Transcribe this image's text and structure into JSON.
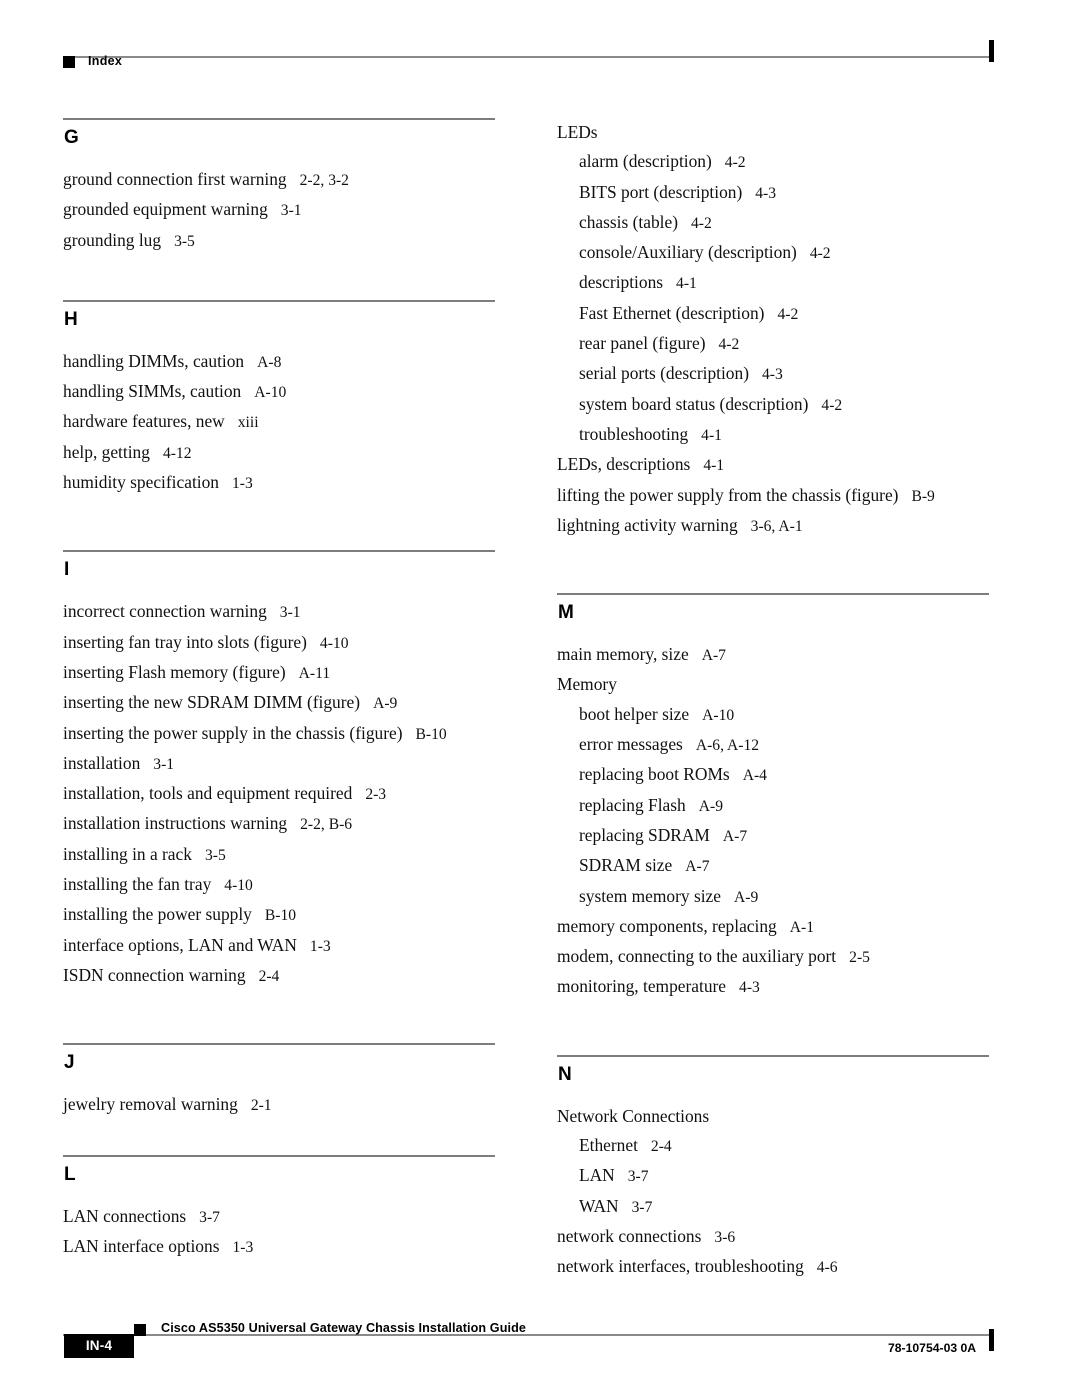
{
  "header": {
    "running_head": "Index",
    "bullet_icon": "black-square-icon"
  },
  "footer": {
    "page_number": "IN-4",
    "document_title": "Cisco AS5350 Universal Gateway Chassis Installation Guide",
    "document_number": "78-10754-03 0A",
    "bullet_icon": "black-square-icon"
  },
  "columns": {
    "left": [
      {
        "letter": "G",
        "entries": [
          {
            "term": "ground connection first warning",
            "locator": "2-2, 3-2",
            "level": 0
          },
          {
            "term": "grounded equipment warning",
            "locator": "3-1",
            "level": 0
          },
          {
            "term": "grounding lug",
            "locator": "3-5",
            "level": 0
          }
        ]
      },
      {
        "letter": "H",
        "entries": [
          {
            "term": "handling DIMMs, caution",
            "locator": "A-8",
            "level": 0
          },
          {
            "term": "handling SIMMs, caution",
            "locator": "A-10",
            "level": 0
          },
          {
            "term": "hardware features, new",
            "locator": "xiii",
            "level": 0
          },
          {
            "term": "help, getting",
            "locator": "4-12",
            "level": 0
          },
          {
            "term": "humidity specification",
            "locator": "1-3",
            "level": 0
          }
        ]
      },
      {
        "letter": "I",
        "entries": [
          {
            "term": "incorrect connection warning",
            "locator": "3-1",
            "level": 0
          },
          {
            "term": "inserting fan tray into slots (figure)",
            "locator": "4-10",
            "level": 0
          },
          {
            "term": "inserting Flash memory (figure)",
            "locator": "A-11",
            "level": 0
          },
          {
            "term": "inserting the new SDRAM DIMM (figure)",
            "locator": "A-9",
            "level": 0
          },
          {
            "term": "inserting the power supply in the chassis (figure)",
            "locator": "B-10",
            "level": 0
          },
          {
            "term": "installation",
            "locator": "3-1",
            "level": 0
          },
          {
            "term": "installation, tools and equipment required",
            "locator": "2-3",
            "level": 0
          },
          {
            "term": "installation instructions warning",
            "locator": "2-2, B-6",
            "level": 0
          },
          {
            "term": "installing in a rack",
            "locator": "3-5",
            "level": 0
          },
          {
            "term": "installing the fan tray",
            "locator": "4-10",
            "level": 0
          },
          {
            "term": "installing the power supply",
            "locator": "B-10",
            "level": 0
          },
          {
            "term": "interface options, LAN and WAN",
            "locator": "1-3",
            "level": 0
          },
          {
            "term": "ISDN connection warning",
            "locator": "2-4",
            "level": 0
          }
        ]
      },
      {
        "letter": "J",
        "entries": [
          {
            "term": "jewelry removal warning",
            "locator": "2-1",
            "level": 0
          }
        ]
      },
      {
        "letter": "L",
        "entries": [
          {
            "term": "LAN connections",
            "locator": "3-7",
            "level": 0
          },
          {
            "term": "LAN interface options",
            "locator": "1-3",
            "level": 0
          }
        ]
      }
    ],
    "right": [
      {
        "letter": "",
        "entries": [
          {
            "term": "LEDs",
            "locator": "",
            "level": 0
          },
          {
            "term": "alarm (description)",
            "locator": "4-2",
            "level": 1
          },
          {
            "term": "BITS port (description)",
            "locator": "4-3",
            "level": 1
          },
          {
            "term": "chassis (table)",
            "locator": "4-2",
            "level": 1
          },
          {
            "term": "console/Auxiliary (description)",
            "locator": "4-2",
            "level": 1
          },
          {
            "term": "descriptions",
            "locator": "4-1",
            "level": 1
          },
          {
            "term": "Fast Ethernet (description)",
            "locator": "4-2",
            "level": 1
          },
          {
            "term": "rear panel (figure)",
            "locator": "4-2",
            "level": 1
          },
          {
            "term": "serial ports (description)",
            "locator": "4-3",
            "level": 1
          },
          {
            "term": "system board status (description)",
            "locator": "4-2",
            "level": 1
          },
          {
            "term": "troubleshooting",
            "locator": "4-1",
            "level": 1
          },
          {
            "term": "LEDs, descriptions",
            "locator": "4-1",
            "level": 0
          },
          {
            "term": "lifting the power supply from the chassis (figure)",
            "locator": "B-9",
            "level": 0
          },
          {
            "term": "lightning activity warning",
            "locator": "3-6, A-1",
            "level": 0
          }
        ]
      },
      {
        "letter": "M",
        "entries": [
          {
            "term": "main memory, size",
            "locator": "A-7",
            "level": 0
          },
          {
            "term": "Memory",
            "locator": "",
            "level": 0
          },
          {
            "term": "boot helper size",
            "locator": "A-10",
            "level": 1
          },
          {
            "term": "error messages",
            "locator": "A-6, A-12",
            "level": 1
          },
          {
            "term": "replacing boot ROMs",
            "locator": "A-4",
            "level": 1
          },
          {
            "term": "replacing Flash",
            "locator": "A-9",
            "level": 1
          },
          {
            "term": "replacing SDRAM",
            "locator": "A-7",
            "level": 1
          },
          {
            "term": "SDRAM size",
            "locator": "A-7",
            "level": 1
          },
          {
            "term": "system memory size",
            "locator": "A-9",
            "level": 1
          },
          {
            "term": "memory components, replacing",
            "locator": "A-1",
            "level": 0
          },
          {
            "term": "modem, connecting to the auxiliary port",
            "locator": "2-5",
            "level": 0
          },
          {
            "term": "monitoring, temperature",
            "locator": "4-3",
            "level": 0
          }
        ]
      },
      {
        "letter": "N",
        "entries": [
          {
            "term": "Network Connections",
            "locator": "",
            "level": 0
          },
          {
            "term": "Ethernet",
            "locator": "2-4",
            "level": 1
          },
          {
            "term": "LAN",
            "locator": "3-7",
            "level": 1
          },
          {
            "term": "WAN",
            "locator": "3-7",
            "level": 1
          },
          {
            "term": "network connections",
            "locator": "3-6",
            "level": 0
          },
          {
            "term": "network interfaces, troubleshooting",
            "locator": "4-6",
            "level": 0
          }
        ]
      }
    ]
  }
}
